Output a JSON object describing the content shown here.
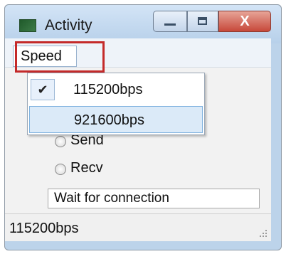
{
  "window": {
    "title": "Activity",
    "close_glyph": "X",
    "icon": "app-window-icon"
  },
  "menu": {
    "speed_label": "Speed",
    "items": [
      {
        "label": "115200bps",
        "checked": true,
        "check_glyph": "✔"
      },
      {
        "label": "921600bps",
        "checked": false,
        "hovered": true
      }
    ]
  },
  "content": {
    "radio_send_label": "Send",
    "radio_recv_label": "Recv",
    "status_field_value": "Wait for connection"
  },
  "statusbar": {
    "text": "115200bps"
  },
  "colors": {
    "highlight_box": "#c42a2a",
    "title_bar": "#c8dcf1",
    "hover_item": "#dbeaf8"
  }
}
